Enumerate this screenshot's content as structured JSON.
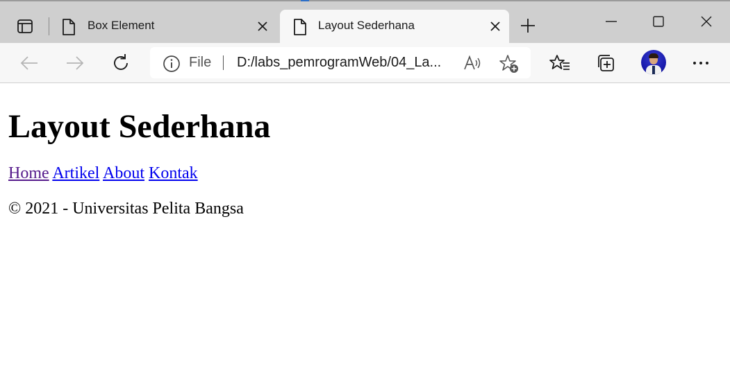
{
  "browser": {
    "tabs": [
      {
        "title": "Box Element",
        "icon": "page-icon",
        "active": false
      },
      {
        "title": "Layout Sederhana",
        "icon": "page-icon",
        "active": true
      }
    ],
    "address": {
      "scheme": "File",
      "url": "D:/labs_pemrogramWeb/04_La..."
    }
  },
  "page": {
    "heading": "Layout Sederhana",
    "nav": [
      "Home",
      "Artikel",
      "About",
      "Kontak"
    ],
    "footer": "© 2021 - Universitas Pelita Bangsa"
  },
  "colors": {
    "link": "#0000ee",
    "visited_link": "#551a8b",
    "tabstrip": "#cfcfcf",
    "toolbar": "#f7f7f7"
  }
}
